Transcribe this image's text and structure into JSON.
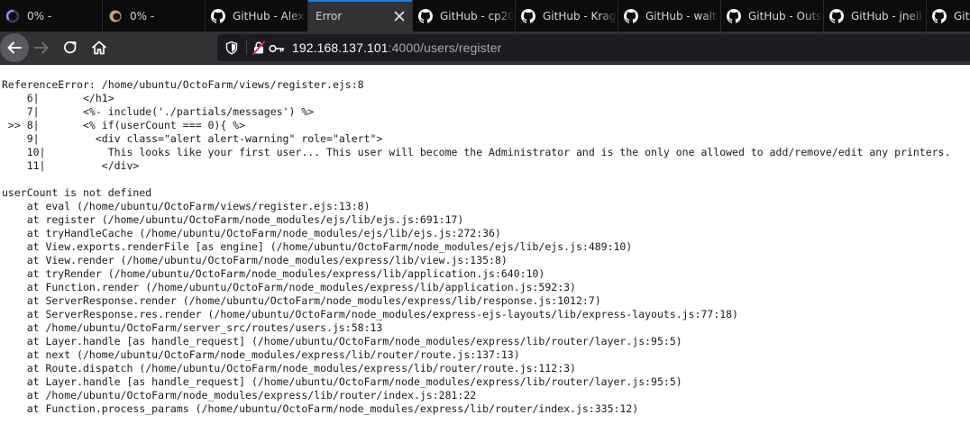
{
  "tabs": [
    {
      "title": "0% -",
      "icon": "loading-icon"
    },
    {
      "title": "0% -",
      "icon": "octofarm-icon"
    },
    {
      "title": "GitHub - Alex",
      "icon": "github-icon"
    },
    {
      "title": "Error",
      "icon": "none",
      "active": true
    },
    {
      "title": "GitHub - cp20",
      "icon": "github-icon"
    },
    {
      "title": "GitHub - Krag",
      "icon": "github-icon"
    },
    {
      "title": "GitHub - walt",
      "icon": "github-icon"
    },
    {
      "title": "GitHub - Outs",
      "icon": "github-icon"
    },
    {
      "title": "GitHub - jneil",
      "icon": "github-icon"
    },
    {
      "title": "GitHub",
      "icon": "github-icon"
    }
  ],
  "address": {
    "host": "192.168.137.101",
    "path": ":4000/users/register"
  },
  "error": {
    "header": "ReferenceError: /home/ubuntu/OctoFarm/views/register.ejs:8",
    "context": [
      "    6|       </h1>",
      "    7|       <%- include('./partials/messages') %>",
      " >> 8|       <% if(userCount === 0){ %>",
      "    9|         <div class=\"alert alert-warning\" role=\"alert\">",
      "    10|          This looks like your first user... This user will become the Administrator and is the only one allowed to add/remove/edit any printers.",
      "    11|         </div>"
    ],
    "blank": "",
    "message": "userCount is not defined",
    "stack": [
      "    at eval (/home/ubuntu/OctoFarm/views/register.ejs:13:8)",
      "    at register (/home/ubuntu/OctoFarm/node_modules/ejs/lib/ejs.js:691:17)",
      "    at tryHandleCache (/home/ubuntu/OctoFarm/node_modules/ejs/lib/ejs.js:272:36)",
      "    at View.exports.renderFile [as engine] (/home/ubuntu/OctoFarm/node_modules/ejs/lib/ejs.js:489:10)",
      "    at View.render (/home/ubuntu/OctoFarm/node_modules/express/lib/view.js:135:8)",
      "    at tryRender (/home/ubuntu/OctoFarm/node_modules/express/lib/application.js:640:10)",
      "    at Function.render (/home/ubuntu/OctoFarm/node_modules/express/lib/application.js:592:3)",
      "    at ServerResponse.render (/home/ubuntu/OctoFarm/node_modules/express/lib/response.js:1012:7)",
      "    at ServerResponse.res.render (/home/ubuntu/OctoFarm/node_modules/express-ejs-layouts/lib/express-layouts.js:77:18)",
      "    at /home/ubuntu/OctoFarm/server_src/routes/users.js:58:13",
      "    at Layer.handle [as handle_request] (/home/ubuntu/OctoFarm/node_modules/express/lib/router/layer.js:95:5)",
      "    at next (/home/ubuntu/OctoFarm/node_modules/express/lib/router/route.js:137:13)",
      "    at Route.dispatch (/home/ubuntu/OctoFarm/node_modules/express/lib/router/route.js:112:3)",
      "    at Layer.handle [as handle_request] (/home/ubuntu/OctoFarm/node_modules/express/lib/router/layer.js:95:5)",
      "    at /home/ubuntu/OctoFarm/node_modules/express/lib/router/index.js:281:22",
      "    at Function.process_params (/home/ubuntu/OctoFarm/node_modules/express/lib/router/index.js:335:12)"
    ]
  }
}
